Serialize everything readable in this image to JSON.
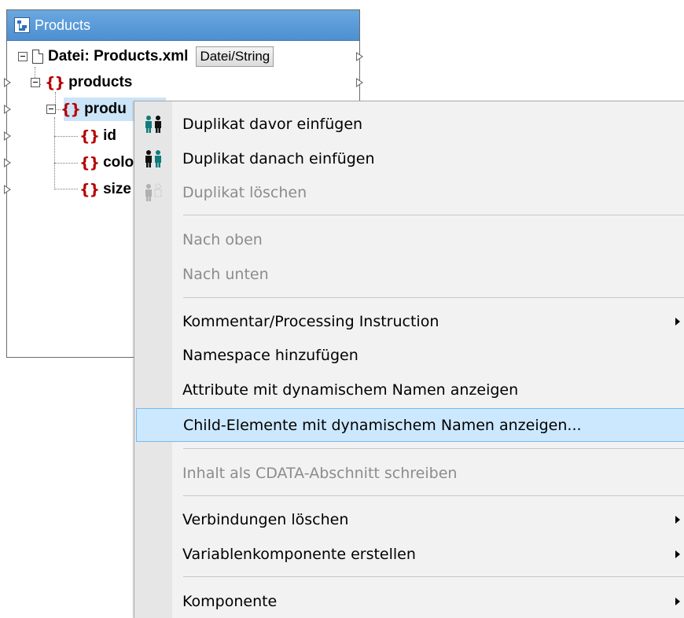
{
  "component": {
    "title": "Products",
    "file_label": "Datei: Products.xml",
    "file_button": "Datei/String",
    "tree": [
      {
        "label": "products"
      },
      {
        "label": "produ"
      },
      {
        "label": "id"
      },
      {
        "label": "colo"
      },
      {
        "label": "size"
      }
    ]
  },
  "context_menu": {
    "items": [
      {
        "label": "Duplikat davor einfügen",
        "icon": "duplicate-insert-before-icon",
        "enabled": true
      },
      {
        "label": "Duplikat danach einfügen",
        "icon": "duplicate-insert-after-icon",
        "enabled": true
      },
      {
        "label": "Duplikat löschen",
        "icon": "duplicate-delete-icon",
        "enabled": false
      },
      {
        "label": "Nach oben",
        "enabled": false
      },
      {
        "label": "Nach unten",
        "enabled": false
      },
      {
        "label": "Kommentar/Processing Instruction",
        "submenu": true,
        "enabled": true
      },
      {
        "label": "Namespace hinzufügen",
        "enabled": true
      },
      {
        "label": "Attribute mit dynamischem Namen anzeigen",
        "enabled": true
      },
      {
        "label": "Child-Elemente mit dynamischem Namen anzeigen...",
        "enabled": true,
        "highlighted": true
      },
      {
        "label": "Inhalt als CDATA-Abschnitt schreiben",
        "enabled": false
      },
      {
        "label": "Verbindungen löschen",
        "submenu": true,
        "enabled": true
      },
      {
        "label": "Variablenkomponente erstellen",
        "submenu": true,
        "enabled": true
      },
      {
        "label": "Komponente",
        "submenu": true,
        "enabled": true
      }
    ]
  },
  "colors": {
    "title_bar": "#5b9bd5",
    "element_braces": "#b40000",
    "menu_highlight": "#cce8ff",
    "disabled_text": "#8c8c8c",
    "icon_teal": "#0f7c7c"
  }
}
